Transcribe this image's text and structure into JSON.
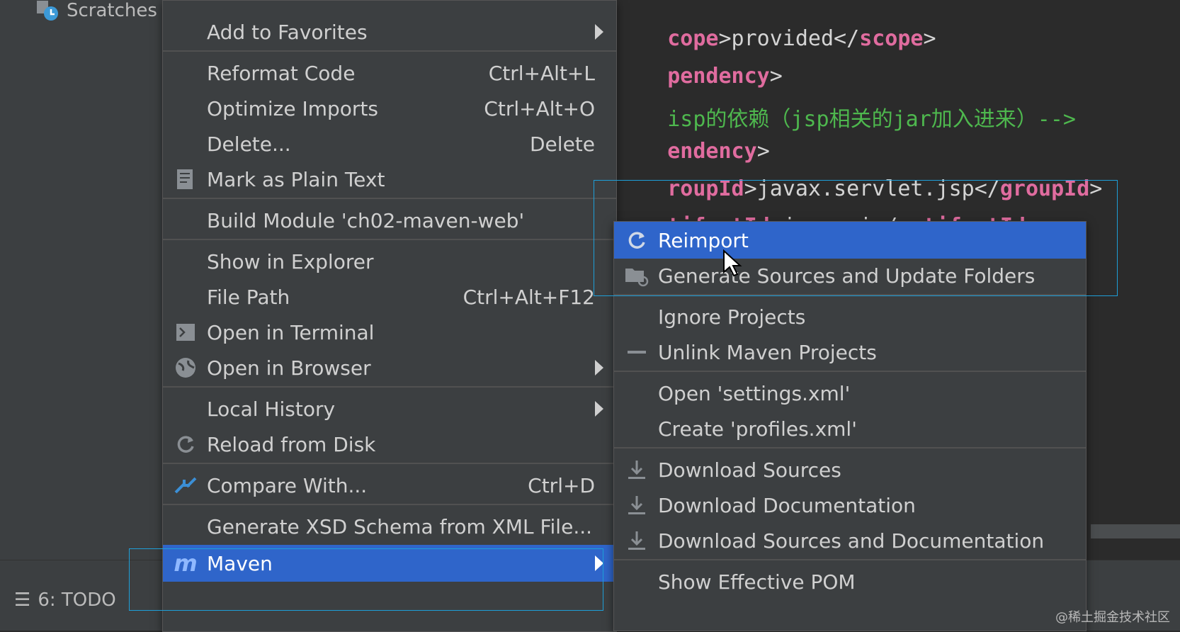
{
  "project_panel": {
    "scratches_label": "Scratches"
  },
  "bottom_bar": {
    "todo_label": "6: TODO"
  },
  "editor": {
    "lines": [
      {
        "pre": "cope",
        "mid": ">provided</",
        "kw": "scope",
        "post": ">"
      },
      {
        "pre": "pendency",
        "mid": ">",
        "kw": "",
        "post": ""
      },
      {
        "comment": "isp的依赖（jsp相关的jar加入进来）-->"
      },
      {
        "pre": "endency",
        "mid": ">",
        "kw": "",
        "post": ""
      },
      {
        "pre": "roupId",
        "mid": ">javax.servlet.jsp</",
        "kw": "groupId",
        "post": ">"
      },
      {
        "pre": "tifactId",
        "mid": ">jsp-api</",
        "kw": "artifactId",
        "post": ">"
      }
    ]
  },
  "context_menu": {
    "add_to_favorites": "Add to Favorites",
    "reformat_code": "Reformat Code",
    "reformat_code_shortcut": "Ctrl+Alt+L",
    "optimize_imports": "Optimize Imports",
    "optimize_imports_shortcut": "Ctrl+Alt+O",
    "delete": "Delete...",
    "delete_shortcut": "Delete",
    "mark_plain_text": "Mark as Plain Text",
    "build_module": "Build Module 'ch02-maven-web'",
    "show_in_explorer": "Show in Explorer",
    "file_path": "File Path",
    "file_path_shortcut": "Ctrl+Alt+F12",
    "open_in_terminal": "Open in Terminal",
    "open_in_browser": "Open in Browser",
    "local_history": "Local History",
    "reload_from_disk": "Reload from Disk",
    "compare_with": "Compare With...",
    "compare_with_shortcut": "Ctrl+D",
    "generate_xsd": "Generate XSD Schema from XML File...",
    "maven": "Maven"
  },
  "maven_menu": {
    "reimport": "Reimport",
    "generate_sources": "Generate Sources and Update Folders",
    "ignore_projects": "Ignore Projects",
    "unlink_projects": "Unlink Maven Projects",
    "open_settings": "Open 'settings.xml'",
    "create_profiles": "Create 'profiles.xml'",
    "download_sources": "Download Sources",
    "download_documentation": "Download Documentation",
    "download_both": "Download Sources and Documentation",
    "show_effective_pom": "Show Effective POM"
  },
  "watermark": "@稀土掘金技术社区",
  "colors": {
    "selection": "#2f65ca",
    "highlight_box": "#1e9fd8",
    "menu_bg": "#3c3f41"
  }
}
